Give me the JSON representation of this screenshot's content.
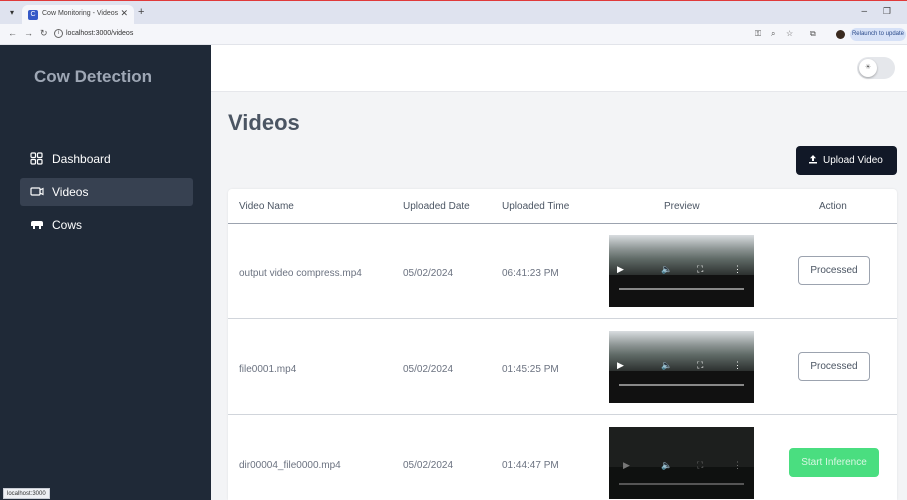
{
  "browser": {
    "tab_title": "Cow Monitoring - Videos",
    "tab_favicon": "C",
    "url": "localhost:3000/videos",
    "relaunch_label": "Relaunch to update",
    "status_url": "localhost:3000"
  },
  "sidebar": {
    "brand": "Cow Detection",
    "items": [
      {
        "label": "Dashboard",
        "icon": "grid-icon"
      },
      {
        "label": "Videos",
        "icon": "video-icon",
        "active": true
      },
      {
        "label": "Cows",
        "icon": "cow-icon"
      }
    ]
  },
  "page": {
    "title": "Videos",
    "upload_label": "Upload Video"
  },
  "table": {
    "columns": [
      "Video Name",
      "Uploaded Date",
      "Uploaded Time",
      "Preview",
      "Action"
    ],
    "rows": [
      {
        "name": "output video compress.mp4",
        "date": "05/02/2024",
        "time": "06:41:23 PM",
        "action": "Processed"
      },
      {
        "name": "file0001.mp4",
        "date": "05/02/2024",
        "time": "01:45:25 PM",
        "action": "Processed"
      },
      {
        "name": "dir00004_file0000.mp4",
        "date": "05/02/2024",
        "time": "01:44:47 PM",
        "action": "Start Inference"
      }
    ]
  },
  "colors": {
    "sidebar_bg": "#1f2937",
    "primary_button": "#111827",
    "inference_green": "#4ade80"
  }
}
